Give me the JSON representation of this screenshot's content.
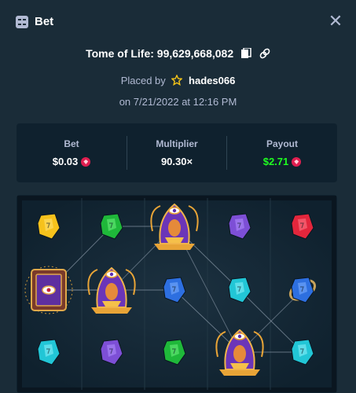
{
  "header": {
    "title": "Bet",
    "close_label": "✕"
  },
  "game": {
    "line": "Tome of Life: 99,629,668,082"
  },
  "placed": {
    "prefix": "Placed by",
    "username": "hades066"
  },
  "date": "on 7/21/2022 at 12:16 PM",
  "stats": {
    "bet": {
      "label": "Bet",
      "value": "$0.03"
    },
    "multiplier": {
      "label": "Multiplier",
      "value": "90.30×"
    },
    "payout": {
      "label": "Payout",
      "value": "$2.71"
    }
  },
  "colors": {
    "background": "#1a2c38",
    "panel": "#0f212e",
    "muted_text": "#b1bad3",
    "payout_green": "#1fff20",
    "currency_red": "#e01e4f"
  },
  "board": {
    "columns": 5,
    "rows": 3,
    "symbols": [
      [
        "gem-yellow",
        "gem-green",
        "pharaoh",
        "gem-purple",
        "gem-red"
      ],
      [
        "tome-scroll",
        "pharaoh",
        "gem-blue",
        "gem-cyan",
        "gem-blue-ring"
      ],
      [
        "gem-cyan",
        "gem-purple",
        "gem-green",
        "pharaoh",
        "gem-cyan"
      ]
    ]
  }
}
